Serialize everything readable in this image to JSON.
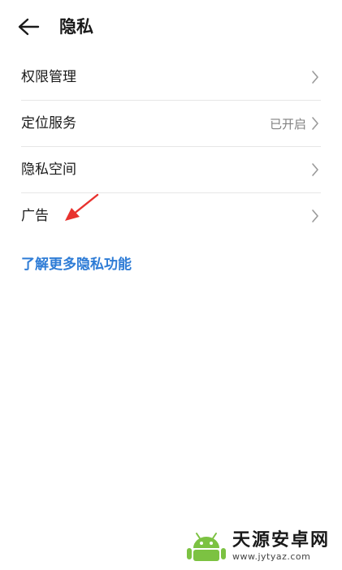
{
  "header": {
    "title": "隐私",
    "back_icon": "arrow-left-icon"
  },
  "items": [
    {
      "label": "权限管理",
      "value": ""
    },
    {
      "label": "定位服务",
      "value": "已开启"
    },
    {
      "label": "隐私空间",
      "value": ""
    },
    {
      "label": "广告",
      "value": ""
    }
  ],
  "learn_more": "了解更多隐私功能",
  "annotation": {
    "icon": "red-arrow-icon",
    "color": "#e8322e"
  },
  "watermark": {
    "title": "天源安卓网",
    "url": "www.jytyaz.com",
    "logo_color": "#7cc242"
  },
  "colors": {
    "link": "#2e7cd6",
    "secondary_text": "#808080",
    "divider": "#e6e6e6"
  }
}
